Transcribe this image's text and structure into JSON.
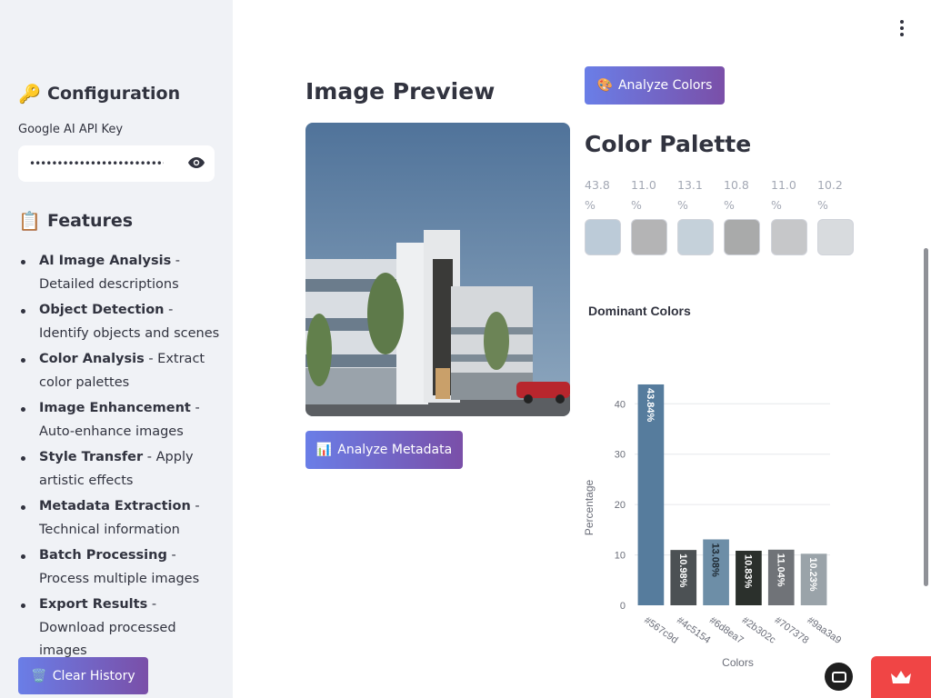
{
  "sidebar": {
    "config_title": "Configuration",
    "config_icon": "key-icon",
    "api_key_label": "Google AI API Key",
    "api_key_value": "••••••••••••••••••••••••••••••",
    "features_title": "Features",
    "features_icon": "clipboard-icon",
    "features": [
      {
        "name": "AI Image Analysis",
        "desc": " - Detailed descriptions"
      },
      {
        "name": "Object Detection",
        "desc": " - Identify objects and scenes"
      },
      {
        "name": "Color Analysis",
        "desc": " - Extract color palettes"
      },
      {
        "name": "Image Enhancement",
        "desc": " - Auto-enhance images"
      },
      {
        "name": "Style Transfer",
        "desc": " - Apply artistic effects"
      },
      {
        "name": "Metadata Extraction",
        "desc": " - Technical information"
      },
      {
        "name": "Batch Processing",
        "desc": " - Process multiple images"
      },
      {
        "name": "Export Results",
        "desc": " - Download processed images"
      }
    ],
    "clear_history_label": "Clear History"
  },
  "main": {
    "image_preview_title": "Image Preview",
    "analyze_metadata_label": "Analyze Metadata",
    "analyze_colors_label": "Analyze Colors",
    "color_palette_title": "Color Palette",
    "palette": [
      {
        "pct_line1": "43.8",
        "pct_line2": "%",
        "color": "#bccbd8"
      },
      {
        "pct_line1": "11.0",
        "pct_line2": "%",
        "color": "#b4b4b5"
      },
      {
        "pct_line1": "13.1",
        "pct_line2": "%",
        "color": "#c5d1da"
      },
      {
        "pct_line1": "10.8",
        "pct_line2": "%",
        "color": "#a9aaaa"
      },
      {
        "pct_line1": "11.0",
        "pct_line2": "%",
        "color": "#c6c7c9"
      },
      {
        "pct_line1": "10.2",
        "pct_line2": "%",
        "color": "#d8dbde"
      }
    ]
  },
  "chart_data": {
    "type": "bar",
    "title": "Dominant Colors",
    "xlabel": "Colors",
    "ylabel": "Percentage",
    "categories": [
      "#567c9d",
      "#4c5154",
      "#6d8ea7",
      "#2b302c",
      "#707378",
      "#9aa3a9"
    ],
    "values": [
      43.84,
      10.98,
      13.08,
      10.83,
      11.04,
      10.23
    ],
    "labels": [
      "43.84%",
      "10.98%",
      "13.08%",
      "10.83%",
      "11.04%",
      "10.23%"
    ],
    "bar_colors": [
      "#567c9d",
      "#4c5154",
      "#6d8ea7",
      "#2b302c",
      "#707378",
      "#9aa3a9"
    ],
    "yticks": [
      0,
      10,
      20,
      30,
      40
    ],
    "ylim": [
      0,
      46
    ],
    "grid": true
  }
}
